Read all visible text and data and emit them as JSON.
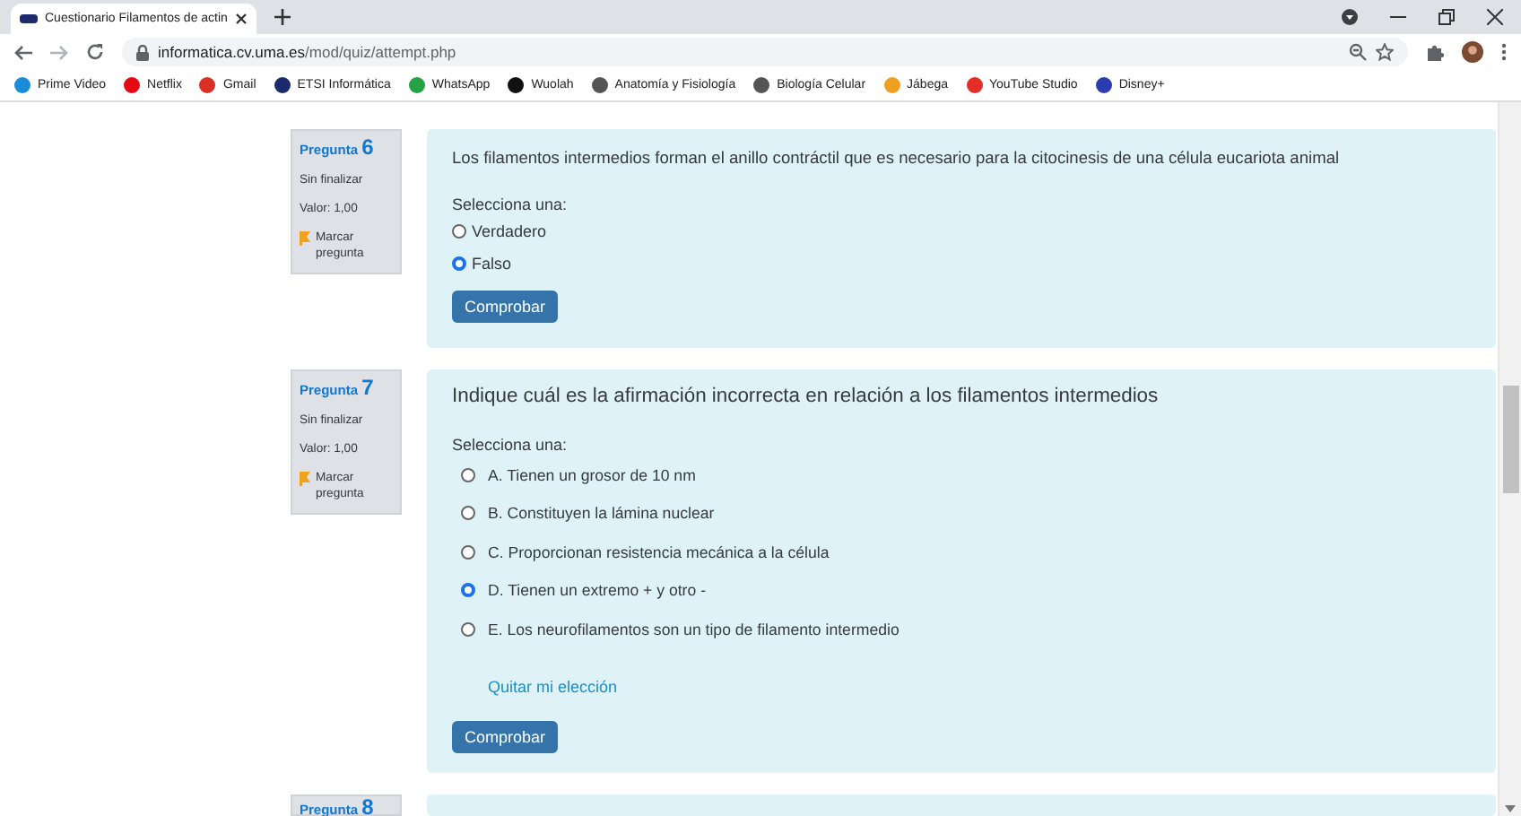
{
  "browser": {
    "tab": {
      "title": "Cuestionario Filamentos de actin"
    },
    "url_host": "informatica.cv.uma.es",
    "url_path": "/mod/quiz/attempt.php",
    "bookmarks": [
      {
        "label": "Prime Video",
        "color": "#1a8cd8"
      },
      {
        "label": "Netflix",
        "color": "#e50914"
      },
      {
        "label": "Gmail",
        "color": "#d93025"
      },
      {
        "label": "ETSI Informática",
        "color": "#1c2a6b"
      },
      {
        "label": "WhatsApp",
        "color": "#25a244"
      },
      {
        "label": "Wuolah",
        "color": "#111111"
      },
      {
        "label": "Anatomía y Fisiología",
        "color": "#555555"
      },
      {
        "label": "Biología Celular",
        "color": "#555555"
      },
      {
        "label": "Jábega",
        "color": "#f0a020"
      },
      {
        "label": "YouTube Studio",
        "color": "#e52d27"
      },
      {
        "label": "Disney+",
        "color": "#2a3cb0"
      }
    ]
  },
  "questions": [
    {
      "label": "Pregunta",
      "number": "6",
      "status": "Sin finalizar",
      "value": "Valor: 1,00",
      "flag_label": "Marcar pregunta",
      "kind": "truefalse",
      "text": "Los filamentos intermedios forman el anillo contráctil que es necesario para la citocinesis de una célula eucariota animal",
      "prompt": "Selecciona una:",
      "options": [
        {
          "label": "Verdadero",
          "selected": false
        },
        {
          "label": "Falso",
          "selected": true
        }
      ],
      "button": "Comprobar"
    },
    {
      "label": "Pregunta",
      "number": "7",
      "status": "Sin finalizar",
      "value": "Valor: 1,00",
      "flag_label": "Marcar pregunta",
      "kind": "multichoice",
      "text": "Indique cuál es la afirmación incorrecta en relación a los filamentos intermedios",
      "prompt": "Selecciona una:",
      "options": [
        {
          "label": "A. Tienen un grosor de 10 nm",
          "selected": false
        },
        {
          "label": "B. Constituyen la lámina nuclear",
          "selected": false
        },
        {
          "label": "C. Proporcionan resistencia mecánica a la célula",
          "selected": false
        },
        {
          "label": "D. Tienen un extremo + y otro -",
          "selected": true
        },
        {
          "label": "E. Los neurofilamentos son un tipo de filamento intermedio",
          "selected": false
        }
      ],
      "clear_link": "Quitar mi elección",
      "button": "Comprobar"
    },
    {
      "label": "Pregunta",
      "number": "8",
      "kind": "partial"
    }
  ]
}
